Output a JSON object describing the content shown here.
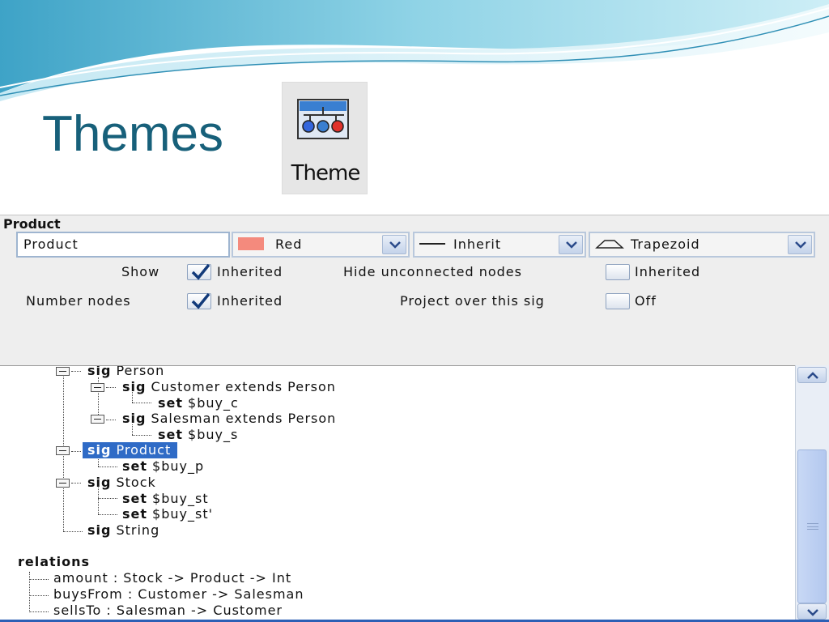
{
  "slide": {
    "title": "Themes",
    "theme_button_label": "Theme"
  },
  "panel": {
    "title": "Product",
    "name_value": "Product",
    "color_combo": "Red",
    "style_combo": "Inherit",
    "shape_combo": "Trapezoid",
    "options": {
      "show_label": "Show",
      "show_value": "Inherited",
      "show_checked": true,
      "hide_label": "Hide unconnected nodes",
      "hide_value": "Inherited",
      "hide_checked": false,
      "number_label": "Number nodes",
      "number_value": "Inherited",
      "number_checked": true,
      "project_label": "Project over this sig",
      "project_value": "Off",
      "project_checked": false
    }
  },
  "tree": {
    "sig_keyword": "sig",
    "set_keyword": "set",
    "person": "Person",
    "customer": "Customer extends Person",
    "buy_c": "$buy_c",
    "salesman": "Salesman extends Person",
    "buy_s": "$buy_s",
    "product": "Product",
    "buy_p": "$buy_p",
    "stock": "Stock",
    "buy_st": "$buy_st",
    "buy_st2": "$buy_st'",
    "string": "String",
    "relations_header": "relations",
    "relations": [
      "amount :  Stock -> Product -> Int",
      "buysFrom :  Customer -> Salesman",
      "sellsTo :  Salesman -> Customer"
    ]
  },
  "colors": {
    "title_teal": "#17607a",
    "selection_blue": "#2f6bc6",
    "swatch_red": "#f48a7d"
  },
  "icons": [
    "theme-palette-icon",
    "chevron-down-icon",
    "checkmark-icon",
    "trapezoid-icon",
    "expander-minus-icon",
    "scroll-up-icon",
    "scroll-down-icon"
  ]
}
